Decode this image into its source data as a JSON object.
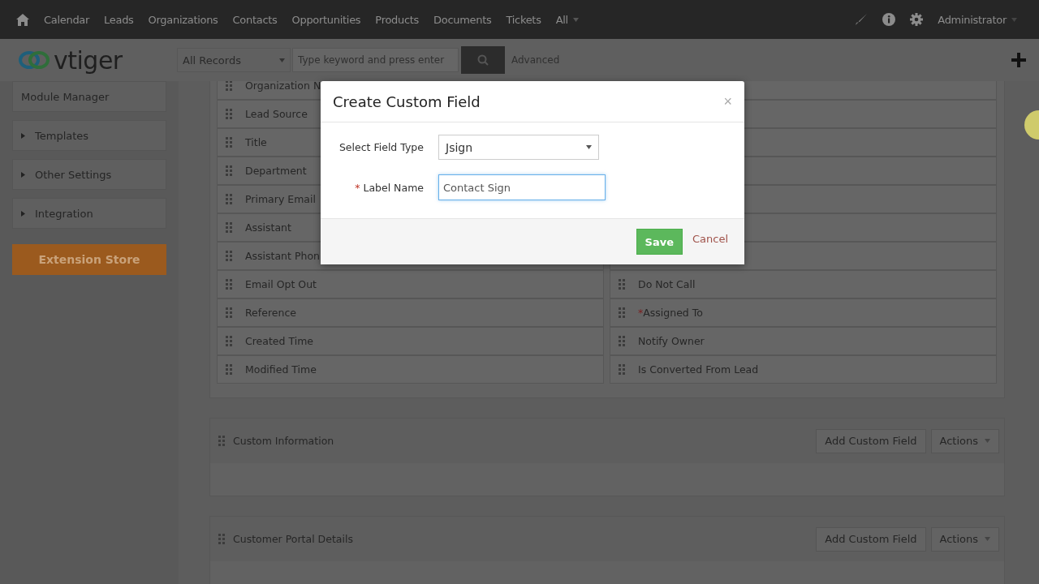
{
  "top_nav": {
    "items": [
      "Calendar",
      "Leads",
      "Organizations",
      "Contacts",
      "Opportunities",
      "Products",
      "Documents",
      "Tickets"
    ],
    "more": "All",
    "user": "Administrator"
  },
  "header": {
    "logo": "vtiger",
    "records_filter": "All Records",
    "search": {
      "placeholder": "Type keyword and press enter"
    },
    "advanced": "Advanced"
  },
  "sidebar": {
    "items": [
      {
        "label": "Module Manager",
        "kind": "plain"
      },
      {
        "label": "Templates",
        "kind": "collapsible"
      },
      {
        "label": "Other Settings",
        "kind": "collapsible"
      },
      {
        "label": "Integration",
        "kind": "collapsible"
      }
    ],
    "extension_store": "Extension Store"
  },
  "field_rows": [
    {
      "left": {
        "label": "Organization N"
      }
    },
    {
      "left": {
        "label": "Lead Source"
      }
    },
    {
      "left": {
        "label": "Title"
      }
    },
    {
      "left": {
        "label": "Department"
      }
    },
    {
      "left": {
        "label": "Primary Email"
      }
    },
    {
      "left": {
        "label": "Assistant"
      }
    },
    {
      "left": {
        "label": "Assistant Phon"
      }
    },
    {
      "left": {
        "label": "Email Opt Out"
      },
      "right": {
        "label": "Do Not Call"
      }
    },
    {
      "left": {
        "label": "Reference"
      },
      "right": {
        "mark": "*",
        "label": "Assigned To"
      }
    },
    {
      "left": {
        "label": "Created Time"
      },
      "right": {
        "label": "Notify Owner"
      }
    },
    {
      "left": {
        "label": "Modified Time"
      },
      "right": {
        "label": "Is Converted From Lead"
      }
    }
  ],
  "blocks": [
    {
      "title": "Custom Information",
      "add_button": "Add Custom Field",
      "actions": "Actions"
    },
    {
      "title": "Customer Portal Details",
      "add_button": "Add Custom Field",
      "actions": "Actions"
    }
  ],
  "modal": {
    "title": "Create Custom Field",
    "close": "×",
    "field_type": {
      "label": "Select Field Type",
      "value": "Jsign"
    },
    "label_name": {
      "mark": "*",
      "label": "Label Name",
      "value": "Contact Sign"
    },
    "save": "Save",
    "cancel": "Cancel"
  }
}
